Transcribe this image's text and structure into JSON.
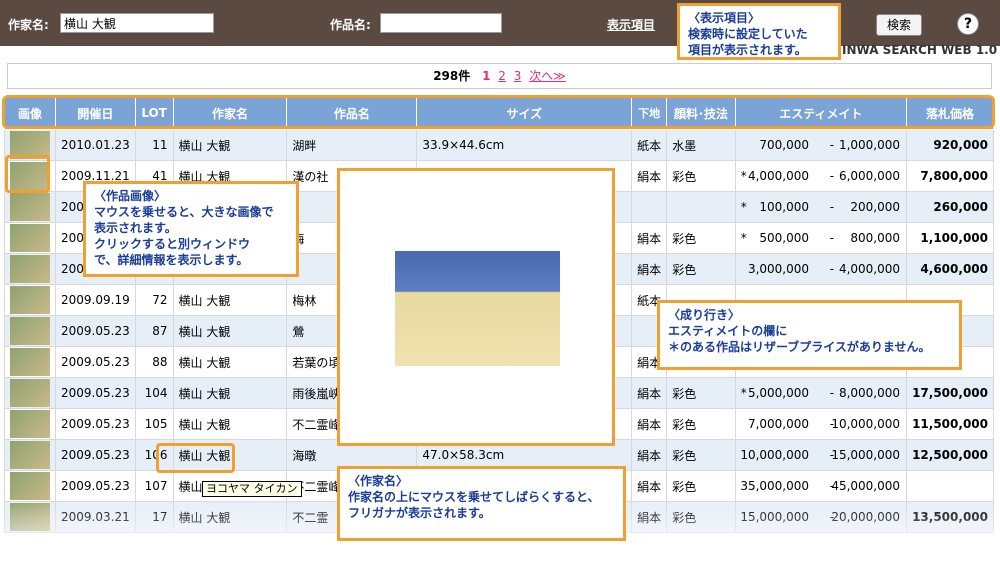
{
  "header": {
    "artist_label": "作家名:",
    "artist_value": "横山 大観",
    "work_label": "作品名:",
    "work_value": "",
    "display_label": "表示項目",
    "search_button": "検索",
    "help": "?",
    "brand": "INWA SEARCH WEB 1.0"
  },
  "pager": {
    "count": "298件",
    "current": "1",
    "p2": "2",
    "p3": "3",
    "next": "次へ≫"
  },
  "columns": [
    "画像",
    "開催日",
    "LOT",
    "作家名",
    "作品名",
    "サイズ",
    "下地",
    "顔料･技法",
    "エスティメイト",
    "落札価格"
  ],
  "rows": [
    {
      "date": "2010.01.23",
      "lot": "11",
      "artist": "横山 大観",
      "title": "湖畔",
      "size": "33.9×44.6cm",
      "base": "紙本",
      "tech": "水墨",
      "mark": "",
      "low": "700,000",
      "high": "1,000,000",
      "price": "920,000"
    },
    {
      "date": "2009.11.21",
      "lot": "41",
      "artist": "横山 大観",
      "title": "漢の社",
      "size": "",
      "base": "絹本",
      "tech": "彩色",
      "mark": "*",
      "low": "4,000,000",
      "high": "6,000,000",
      "price": "7,800,000"
    },
    {
      "date": "2009",
      "lot": "",
      "artist": "",
      "title": "",
      "size": "",
      "base": "",
      "tech": "",
      "mark": "*",
      "low": "100,000",
      "high": "200,000",
      "price": "260,000"
    },
    {
      "date": "2009",
      "lot": "",
      "artist": "",
      "title": "梅",
      "size": "",
      "base": "絹本",
      "tech": "彩色",
      "mark": "*",
      "low": "500,000",
      "high": "800,000",
      "price": "1,100,000"
    },
    {
      "date": "2009",
      "lot": "",
      "artist": "",
      "title": "",
      "size": "",
      "base": "絹本",
      "tech": "彩色",
      "mark": "",
      "low": "3,000,000",
      "high": "4,000,000",
      "price": "4,600,000"
    },
    {
      "date": "2009.09.19",
      "lot": "72",
      "artist": "横山 大観",
      "title": "梅林",
      "size": "",
      "base": "紙本",
      "tech": "",
      "mark": "",
      "low": "",
      "high": "",
      "price": ""
    },
    {
      "date": "2009.05.23",
      "lot": "87",
      "artist": "横山 大観",
      "title": "鶯",
      "size": "",
      "base": "",
      "tech": "",
      "mark": "",
      "low": "",
      "high": "",
      "price": ""
    },
    {
      "date": "2009.05.23",
      "lot": "88",
      "artist": "横山 大観",
      "title": "若葉の頃",
      "size": "",
      "base": "絹本",
      "tech": "",
      "mark": "",
      "low": "",
      "high": "",
      "price": ""
    },
    {
      "date": "2009.05.23",
      "lot": "104",
      "artist": "横山 大観",
      "title": "雨後嵐峡",
      "size": "",
      "base": "絹本",
      "tech": "彩色",
      "mark": "*",
      "low": "5,000,000",
      "high": "8,000,000",
      "price": "17,500,000"
    },
    {
      "date": "2009.05.23",
      "lot": "105",
      "artist": "横山 大観",
      "title": "不二霊峰",
      "size": "",
      "base": "絹本",
      "tech": "彩色",
      "mark": "",
      "low": "7,000,000",
      "high": "10,000,000",
      "price": "11,500,000"
    },
    {
      "date": "2009.05.23",
      "lot": "106",
      "artist": "横山 大観",
      "title": "海暾",
      "size": "47.0×58.3cm",
      "base": "絹本",
      "tech": "彩色",
      "mark": "",
      "low": "10,000,000",
      "high": "15,000,000",
      "price": "12,500,000"
    },
    {
      "date": "2009.05.23",
      "lot": "107",
      "artist": "横山 大",
      "title": "不二霊峰",
      "size": "",
      "base": "絹本",
      "tech": "彩色",
      "mark": "",
      "low": "35,000,000",
      "high": "45,000,000",
      "price": ""
    },
    {
      "date": "2009.03.21",
      "lot": "17",
      "artist": "横山 大観",
      "title": "不二霊",
      "size": "",
      "base": "絹本",
      "tech": "彩色",
      "mark": "",
      "low": "15,000,000",
      "high": "20,000,000",
      "price": "13,500,000"
    }
  ],
  "tooltip": "ヨコヤマ タイカン",
  "callouts": {
    "display": "〈表示項目〉\n検索時に設定していた\n項目が表示されます。",
    "image": "〈作品画像〉\nマウスを乗せると、大きな画像で\n表示されます。\nクリックすると別ウィンドウ\nで、詳細情報を表示します。",
    "estimate": "〈成り行き〉\nエスティメイトの欄に\n＊のある作品はリザーブプライスがありません。",
    "artist": "〈作家名〉\n作家名の上にマウスを乗せてしばらくすると、\nフリガナが表示されます。"
  }
}
